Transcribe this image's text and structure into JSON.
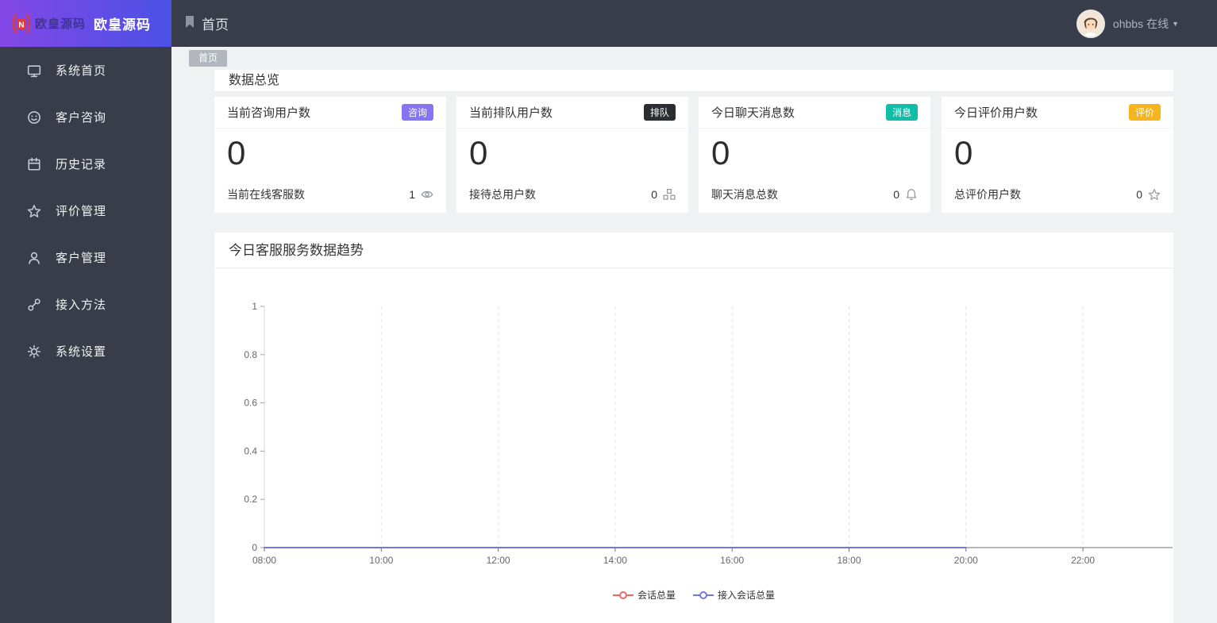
{
  "colors": {
    "topbar_bg": "#393d49",
    "sidebar_bg": "#393d49",
    "logo_gradient_start": "#8447e6",
    "logo_gradient_end": "#4a51e6",
    "badge_consult": "#8575f2",
    "badge_queue": "#2b2d33",
    "badge_message": "#10bda6",
    "badge_rating": "#f6b51e",
    "series_session": "#ee6666",
    "series_access": "#7477de"
  },
  "topbar": {
    "logo_mark": "N",
    "logo_text": "欧皇源码",
    "brand": "欧皇源码",
    "breadcrumb": "首页",
    "username": "ohbbs",
    "status": "在线",
    "caret": "▼"
  },
  "tab_chip": {
    "label": "首页"
  },
  "sidebar": {
    "items": [
      {
        "label": "系统首页",
        "icon": "monitor-icon"
      },
      {
        "label": "客户咨询",
        "icon": "smiley-icon"
      },
      {
        "label": "历史记录",
        "icon": "calendar-icon"
      },
      {
        "label": "评价管理",
        "icon": "star-icon"
      },
      {
        "label": "客户管理",
        "icon": "user-icon"
      },
      {
        "label": "接入方法",
        "icon": "link-icon"
      },
      {
        "label": "系统设置",
        "icon": "gear-icon"
      }
    ]
  },
  "overview": {
    "title": "数据总览"
  },
  "stat_cards": [
    {
      "title": "当前咨询用户数",
      "badge": "咨询",
      "value": "0",
      "sub_label": "当前在线客服数",
      "sub_value": "1",
      "icon": "eye-icon"
    },
    {
      "title": "当前排队用户数",
      "badge": "排队",
      "value": "0",
      "sub_label": "接待总用户数",
      "sub_value": "0",
      "icon": "group-icon"
    },
    {
      "title": "今日聊天消息数",
      "badge": "消息",
      "value": "0",
      "sub_label": "聊天消息总数",
      "sub_value": "0",
      "icon": "bell-icon"
    },
    {
      "title": "今日评价用户数",
      "badge": "评价",
      "value": "0",
      "sub_label": "总评价用户数",
      "sub_value": "0",
      "icon": "star-icon"
    }
  ],
  "chart_card": {
    "title": "今日客服服务数据趋势"
  },
  "chart_data": {
    "type": "line",
    "title": "今日客服服务数据趋势",
    "x": [
      "08:00",
      "10:00",
      "12:00",
      "14:00",
      "16:00",
      "18:00",
      "20:00",
      "22:00"
    ],
    "series": [
      {
        "name": "会话总量",
        "color": "#ee6666",
        "values": [
          0,
          0,
          0,
          0,
          0,
          0,
          0
        ]
      },
      {
        "name": "接入会话总量",
        "color": "#7477de",
        "values": [
          0,
          0,
          0,
          0,
          0,
          0,
          0
        ]
      }
    ],
    "ylim": [
      0,
      1
    ],
    "yticks": [
      0,
      0.2,
      0.4,
      0.6,
      0.8,
      1
    ],
    "xlabel": "",
    "ylabel": "",
    "grid": "vertical-dashed",
    "legend_position": "bottom"
  }
}
